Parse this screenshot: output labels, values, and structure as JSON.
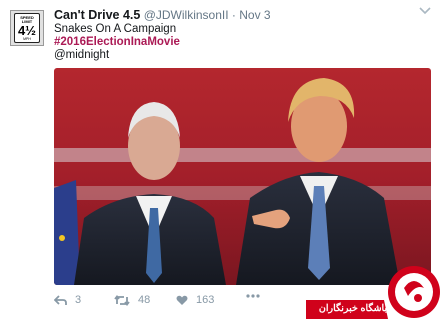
{
  "tweet": {
    "display_name": "Can't Drive 4.5",
    "handle": "@JDWilkinsonII",
    "separator": "·",
    "date": "Nov 3",
    "line1": "Snakes On A Campaign",
    "line2": "#2016ElectionInaMovie",
    "line3": "@midnight"
  },
  "avatar": {
    "sign_top": "SPEED",
    "sign_mid": "LIMIT",
    "sign_number": "4½",
    "sign_unit": "MPH"
  },
  "actions": {
    "reply_count": "3",
    "retweet_count": "48",
    "like_count": "163"
  },
  "watermark": {
    "text": "باشگاه خبرنگاران"
  },
  "icons": {
    "reply": "reply-icon",
    "retweet": "retweet-icon",
    "like": "heart-icon",
    "more": "more-icon",
    "chevron": "chevron-down-icon"
  },
  "colors": {
    "hashtag": "#ab1a55",
    "meta": "#657786",
    "action": "#8899a6",
    "watermark": "#d0021b"
  }
}
